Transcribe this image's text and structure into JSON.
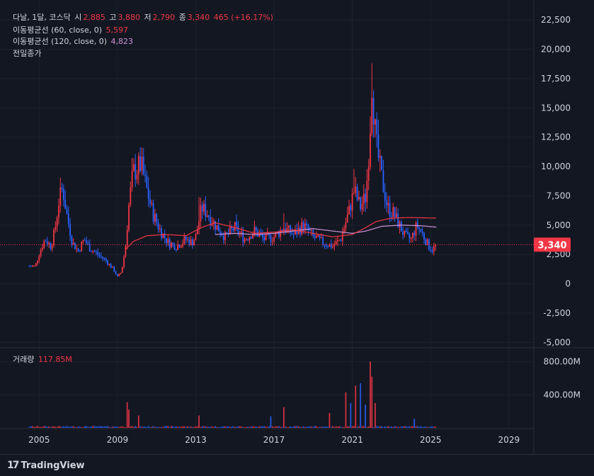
{
  "legend": {
    "symbol": "다날, 1달, 코스닥",
    "open_label": "시",
    "open": "2,885",
    "high_label": "고",
    "high": "3,880",
    "low_label": "저",
    "low": "2,790",
    "close_label": "종",
    "close": "3,340",
    "change": "465 (+16.17%)",
    "ma60_label": "이동평균선 (60, close, 0)",
    "ma60_value": "5,597",
    "ma120_label": "이동평균선 (120, close, 0)",
    "ma120_value": "4,823",
    "prev_close_label": "전일종가"
  },
  "volume_legend": {
    "label": "거래량",
    "value": "117.85M"
  },
  "last_price_tag": "3,340",
  "footer": {
    "brand": "TradingView"
  },
  "colors": {
    "up": "#f23645",
    "down": "#2962ff",
    "ma60": "#f23645",
    "ma120": "#ce93d8",
    "bg": "#131722",
    "grid": "#1e222d"
  },
  "chart_data": {
    "type": "candlestick",
    "yticks": [
      "22,500",
      "20,000",
      "17,500",
      "15,000",
      "12,500",
      "10,000",
      "7,500",
      "5,000",
      "2,500",
      "0",
      "-2,500",
      "-5,000"
    ],
    "ytick_values": [
      22500,
      20000,
      17500,
      15000,
      12500,
      10000,
      7500,
      5000,
      2500,
      0,
      -2500,
      -5000
    ],
    "ylim": [
      -5400,
      24200
    ],
    "xticks": [
      "2005",
      "2009",
      "2013",
      "2017",
      "2021",
      "2025",
      "2029"
    ],
    "xtick_years": [
      2005,
      2009,
      2013,
      2017,
      2021,
      2025,
      2029
    ],
    "xlim": [
      2003.0,
      2030.2
    ],
    "volume_ticks": [
      "800.00M",
      "400.00M"
    ],
    "volume_tick_values": [
      800,
      400
    ],
    "volume_max": 960,
    "price_anchors": [
      [
        2004.5,
        1500
      ],
      [
        2004.8,
        1500
      ],
      [
        2005.0,
        2600
      ],
      [
        2005.3,
        3800
      ],
      [
        2005.6,
        3200
      ],
      [
        2005.8,
        4500
      ],
      [
        2006.0,
        7000
      ],
      [
        2006.2,
        8200
      ],
      [
        2006.4,
        6000
      ],
      [
        2006.7,
        3500
      ],
      [
        2007.0,
        2800
      ],
      [
        2007.3,
        3800
      ],
      [
        2007.6,
        3000
      ],
      [
        2008.0,
        2500
      ],
      [
        2008.4,
        2000
      ],
      [
        2008.8,
        1200
      ],
      [
        2009.0,
        600
      ],
      [
        2009.2,
        1000
      ],
      [
        2009.4,
        3000
      ],
      [
        2009.6,
        7000
      ],
      [
        2009.8,
        9500
      ],
      [
        2010.0,
        9800
      ],
      [
        2010.2,
        10200
      ],
      [
        2010.5,
        8000
      ],
      [
        2010.8,
        6000
      ],
      [
        2011.2,
        4500
      ],
      [
        2011.6,
        3500
      ],
      [
        2012.0,
        3200
      ],
      [
        2012.5,
        3800
      ],
      [
        2012.8,
        3500
      ],
      [
        2013.0,
        4000
      ],
      [
        2013.3,
        6500
      ],
      [
        2013.6,
        6000
      ],
      [
        2014.0,
        5000
      ],
      [
        2014.5,
        4000
      ],
      [
        2015.0,
        4800
      ],
      [
        2015.5,
        3800
      ],
      [
        2016.0,
        4500
      ],
      [
        2016.5,
        3800
      ],
      [
        2017.0,
        4000
      ],
      [
        2017.5,
        4800
      ],
      [
        2018.0,
        4200
      ],
      [
        2018.5,
        5000
      ],
      [
        2019.0,
        4000
      ],
      [
        2019.5,
        3500
      ],
      [
        2020.0,
        3200
      ],
      [
        2020.4,
        3800
      ],
      [
        2020.8,
        6000
      ],
      [
        2021.1,
        8000
      ],
      [
        2021.4,
        6500
      ],
      [
        2021.7,
        7500
      ],
      [
        2021.9,
        13000
      ],
      [
        2022.0,
        17500
      ],
      [
        2022.2,
        12000
      ],
      [
        2022.5,
        9000
      ],
      [
        2022.8,
        6500
      ],
      [
        2023.1,
        6000
      ],
      [
        2023.4,
        5000
      ],
      [
        2023.7,
        4000
      ],
      [
        2024.0,
        3800
      ],
      [
        2024.3,
        5000
      ],
      [
        2024.6,
        4200
      ],
      [
        2024.9,
        3200
      ],
      [
        2025.1,
        2900
      ],
      [
        2025.3,
        3340
      ]
    ],
    "spikes": [
      {
        "x": 2022.0,
        "high": 18800
      },
      {
        "x": 2010.1,
        "high": 11200
      },
      {
        "x": 2006.2,
        "high": 8600
      },
      {
        "x": 2021.1,
        "high": 9800
      },
      {
        "x": 2013.2,
        "high": 7400
      },
      {
        "x": 2017.5,
        "high": 6000
      }
    ],
    "ma60_anchors": [
      [
        2009.4,
        2900
      ],
      [
        2009.8,
        3600
      ],
      [
        2010.5,
        4100
      ],
      [
        2011.5,
        4200
      ],
      [
        2012.5,
        4100
      ],
      [
        2013.3,
        4800
      ],
      [
        2014.0,
        5200
      ],
      [
        2015.0,
        4800
      ],
      [
        2016.0,
        4300
      ],
      [
        2017.0,
        4400
      ],
      [
        2018.0,
        4600
      ],
      [
        2019.0,
        4300
      ],
      [
        2020.0,
        4000
      ],
      [
        2021.0,
        4200
      ],
      [
        2021.7,
        4800
      ],
      [
        2022.2,
        5300
      ],
      [
        2023.0,
        5600
      ],
      [
        2024.0,
        5650
      ],
      [
        2025.3,
        5597
      ]
    ],
    "ma120_anchors": [
      [
        2014.0,
        4200
      ],
      [
        2015.0,
        4300
      ],
      [
        2016.0,
        4200
      ],
      [
        2017.0,
        4300
      ],
      [
        2018.0,
        4500
      ],
      [
        2019.0,
        4700
      ],
      [
        2020.0,
        4500
      ],
      [
        2021.0,
        4300
      ],
      [
        2021.7,
        4500
      ],
      [
        2022.5,
        4900
      ],
      [
        2023.5,
        5000
      ],
      [
        2024.5,
        4950
      ],
      [
        2025.3,
        4823
      ]
    ],
    "volume_spikes": [
      {
        "x": 2009.5,
        "v": 310
      },
      {
        "x": 2009.6,
        "v": 220
      },
      {
        "x": 2010.1,
        "v": 150
      },
      {
        "x": 2013.2,
        "v": 150
      },
      {
        "x": 2016.8,
        "v": 140
      },
      {
        "x": 2017.5,
        "v": 250
      },
      {
        "x": 2019.8,
        "v": 180
      },
      {
        "x": 2020.7,
        "v": 430
      },
      {
        "x": 2020.9,
        "v": 300
      },
      {
        "x": 2021.2,
        "v": 510
      },
      {
        "x": 2021.4,
        "v": 540
      },
      {
        "x": 2021.7,
        "v": 280
      },
      {
        "x": 2021.9,
        "v": 800
      },
      {
        "x": 2022.0,
        "v": 620
      },
      {
        "x": 2022.2,
        "v": 300
      },
      {
        "x": 2024.2,
        "v": 110
      },
      {
        "x": 2025.3,
        "v": 118
      }
    ]
  }
}
